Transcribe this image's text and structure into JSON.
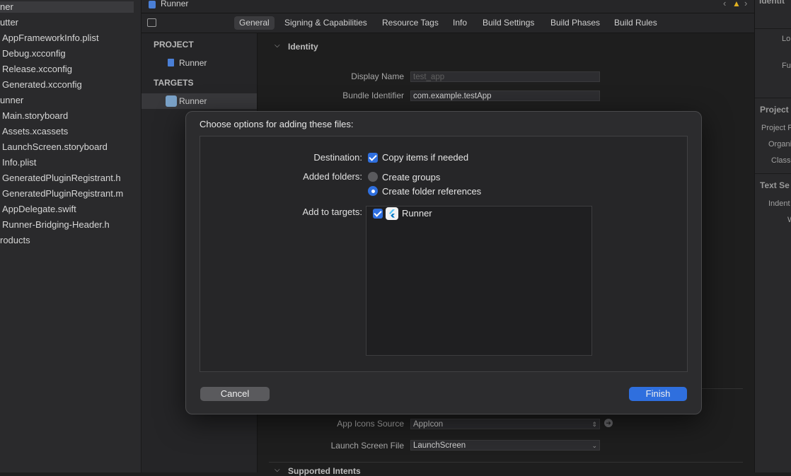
{
  "navigator": {
    "items": [
      {
        "label": "ner",
        "group": true
      },
      {
        "label": "utter",
        "group": true
      },
      {
        "label": "AppFrameworkInfo.plist"
      },
      {
        "label": "Debug.xcconfig"
      },
      {
        "label": "Release.xcconfig"
      },
      {
        "label": "Generated.xcconfig"
      },
      {
        "label": "unner",
        "group": true
      },
      {
        "label": "Main.storyboard"
      },
      {
        "label": "Assets.xcassets"
      },
      {
        "label": "LaunchScreen.storyboard"
      },
      {
        "label": "Info.plist"
      },
      {
        "label": "GeneratedPluginRegistrant.h"
      },
      {
        "label": "GeneratedPluginRegistrant.m"
      },
      {
        "label": "AppDelegate.swift"
      },
      {
        "label": "Runner-Bridging-Header.h"
      },
      {
        "label": "roducts",
        "group": true
      }
    ]
  },
  "jumpbar": {
    "title": "Runner"
  },
  "tabs": [
    "General",
    "Signing & Capabilities",
    "Resource Tags",
    "Info",
    "Build Settings",
    "Build Phases",
    "Build Rules"
  ],
  "project_list": {
    "project_header": "PROJECT",
    "project_item": "Runner",
    "targets_header": "TARGETS",
    "target_item": "Runner"
  },
  "settings": {
    "identity_header": "Identity",
    "display_name_label": "Display Name",
    "display_name_placeholder": "test_app",
    "bundle_id_label": "Bundle Identifier",
    "bundle_id_value": "com.example.testApp",
    "app_icons_label": "App Icons Source",
    "app_icons_value": "AppIcon",
    "launch_screen_label": "Launch Screen File",
    "launch_screen_value": "LaunchScreen",
    "supported_intents": "Supported Intents"
  },
  "inspector": {
    "identity": "Identit",
    "lo": "Lo",
    "fu": "Fu",
    "project_header": "Project",
    "project_f": "Project F",
    "organi": "Organi",
    "class": "Class",
    "text_settings": "Text Se",
    "indent": "Indent",
    "w": "W"
  },
  "dialog": {
    "title": "Choose options for adding these files:",
    "destination_label": "Destination:",
    "copy_items": "Copy items if needed",
    "added_folders_label": "Added folders:",
    "create_groups": "Create groups",
    "create_folder_refs": "Create folder references",
    "add_to_targets_label": "Add to targets:",
    "target_runner": "Runner",
    "cancel": "Cancel",
    "finish": "Finish"
  },
  "colors": {
    "accent": "#2f6fde",
    "background": "#1e1e1e"
  }
}
